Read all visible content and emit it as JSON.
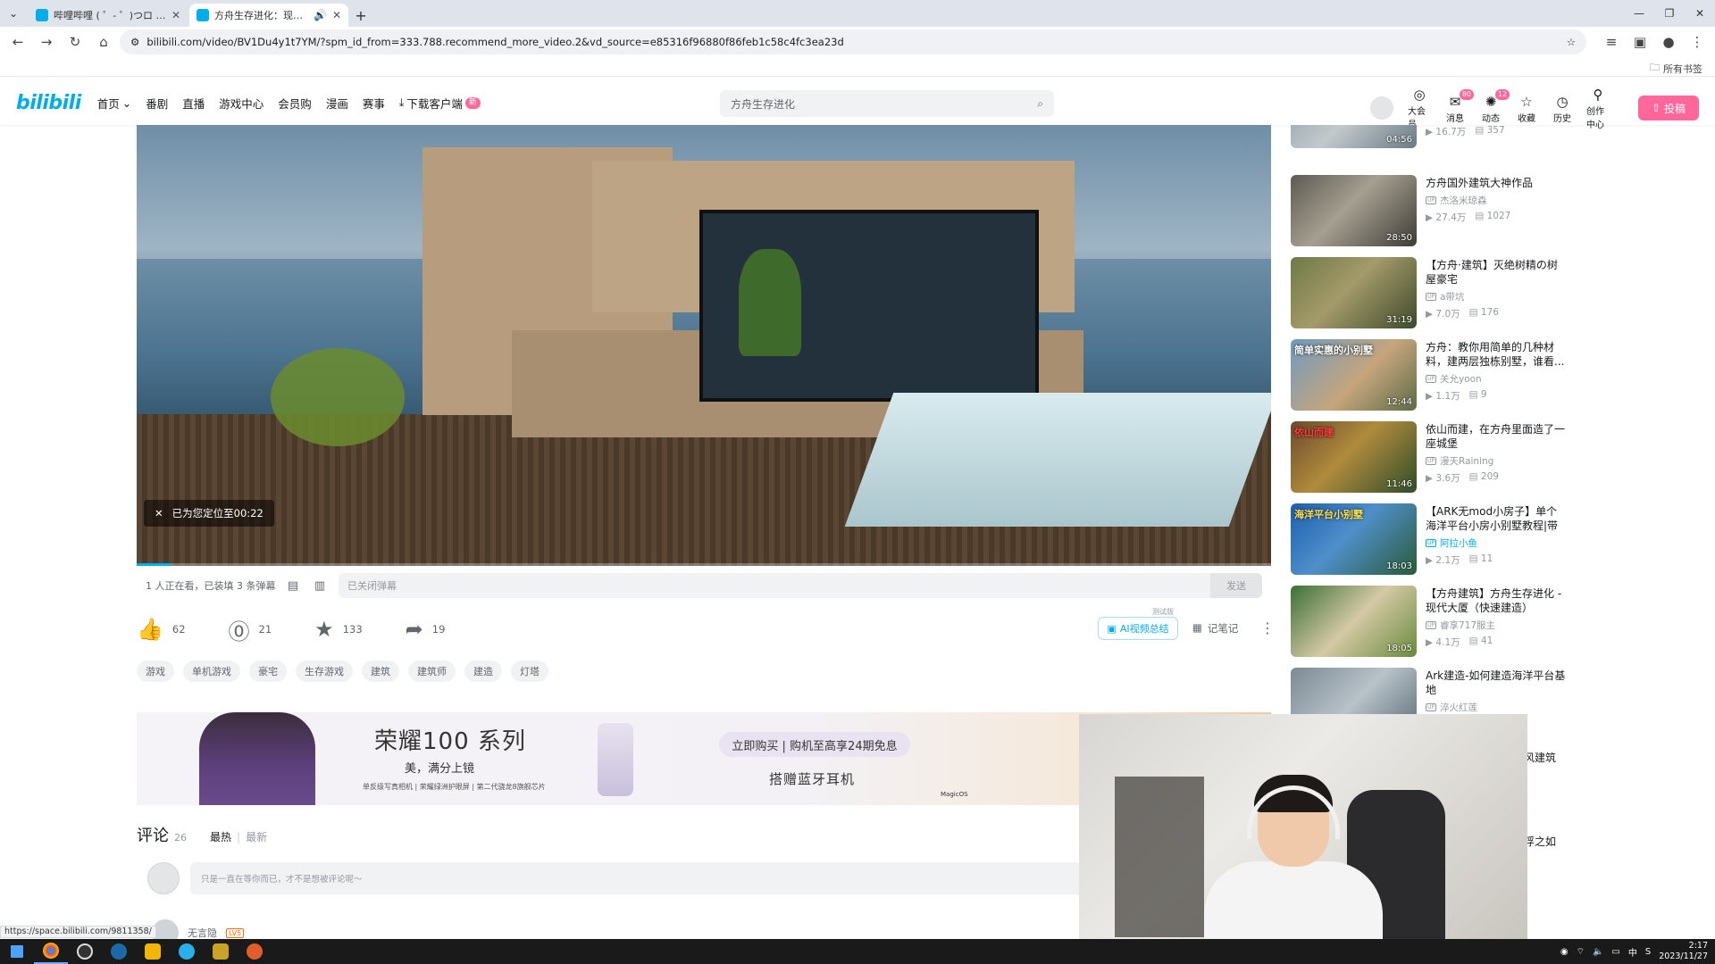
{
  "browser": {
    "tabs": [
      {
        "title": "哔哩哔哩 ( ゜- ゜)つロ 干杯~-bilibili",
        "active": false
      },
      {
        "title": "方舟生存进化：现代豪宅建造",
        "active": true
      }
    ],
    "new_tab": "+",
    "url": "bilibili.com/video/BV1Du4y1t7YM/?spm_id_from=333.788.recommend_more_video.2&vd_source=e85316f96880f86feb1c58c4fc3ea23d",
    "all_bookmarks": "所有书签"
  },
  "header": {
    "logo": "bilibili",
    "nav": [
      {
        "label": "首页"
      },
      {
        "label": "番剧"
      },
      {
        "label": "直播"
      },
      {
        "label": "游戏中心"
      },
      {
        "label": "会员购"
      },
      {
        "label": "漫画"
      },
      {
        "label": "赛事"
      },
      {
        "label": "下载客户端"
      }
    ],
    "download_badge": "新",
    "search_placeholder": "方舟生存进化",
    "right_nav": [
      {
        "label": "大会员",
        "icon": "vip-icon",
        "count": ""
      },
      {
        "label": "消息",
        "icon": "message-icon",
        "count": "80"
      },
      {
        "label": "动态",
        "icon": "dynamic-icon",
        "count": "12"
      },
      {
        "label": "收藏",
        "icon": "favorite-icon",
        "count": ""
      },
      {
        "label": "历史",
        "icon": "history-icon",
        "count": ""
      },
      {
        "label": "创作中心",
        "icon": "creator-icon",
        "count": ""
      }
    ],
    "upload_label": "投稿",
    "accent": "#00aeec",
    "pink": "#ff6699"
  },
  "player": {
    "toast": "已为您定位至00:22",
    "progress": 0.03
  },
  "danmaku": {
    "watching": "1 人正在看，已装填 3 条弹幕",
    "input_placeholder": "已关闭弹幕",
    "send": "发送"
  },
  "actions": {
    "like": "62",
    "coin": "21",
    "favorite": "133",
    "share": "19",
    "ai_summary": "AI视频总结",
    "ai_test": "测试版",
    "notes": "记笔记"
  },
  "tags": [
    "游戏",
    "单机游戏",
    "豪宅",
    "生存游戏",
    "建筑",
    "建筑师",
    "建造",
    "灯塔"
  ],
  "ad": {
    "headline": "荣耀100 系列",
    "sub": "美，满分上镜",
    "fine": "单反级写真相机 | 荣耀绿洲护眼屏 | 第二代骁龙8旗舰芯片",
    "pill": "立即购买 | 购机至高享24期免息",
    "gift": "搭赠蓝牙耳机",
    "brand": "MagicOS"
  },
  "comments": {
    "title": "评论",
    "count": "26",
    "sort_hot": "最热",
    "sort_sep": "|",
    "sort_new": "最新",
    "input_placeholder": "只是一直在等你而已，才不是想被评论呢～",
    "first_user": "无言隐",
    "first_user_level": "LV5"
  },
  "recommendations": [
    {
      "title": "",
      "up": "",
      "views": "16.7万",
      "danmaku": "357",
      "duration": "04:56",
      "overlay": "",
      "charged": false
    },
    {
      "title": "方舟国外建筑大神作品",
      "up": "杰洛米琼森",
      "views": "27.4万",
      "danmaku": "1027",
      "duration": "28:50",
      "overlay": "",
      "charged": false
    },
    {
      "title": "【方舟·建筑】灭绝树精の树屋豪宅",
      "up": "a带坑",
      "views": "7.0万",
      "danmaku": "176",
      "duration": "31:19",
      "overlay": "",
      "charged": false
    },
    {
      "title": "方舟：教你用简单的几种材料，建两层独栋别墅，谁看...",
      "up": "关允yoon",
      "views": "1.1万",
      "danmaku": "9",
      "duration": "12:44",
      "overlay": "简单实惠的小别墅",
      "charged": false
    },
    {
      "title": "依山而建，在方舟里面造了一座城堡",
      "up": "漫天Raining",
      "views": "3.6万",
      "danmaku": "209",
      "duration": "11:46",
      "overlay": "依山而建",
      "charged": false
    },
    {
      "title": "【ARK无mod小房子】单个海洋平台小房小别墅教程|带水...",
      "up": "阿拉小鱼",
      "views": "2.1万",
      "danmaku": "11",
      "duration": "18:03",
      "overlay": "海洋平台小别墅",
      "charged": true
    },
    {
      "title": "【方舟建筑】方舟生存进化 - 现代大厦（快速建造）",
      "up": "睿享717服主",
      "views": "4.1万",
      "danmaku": "41",
      "duration": "18:05",
      "overlay": "",
      "charged": false
    },
    {
      "title": "Ark建造-如何建造海洋平台基地",
      "up": "淬火红莲",
      "views": "",
      "danmaku": "",
      "duration": "",
      "overlay": "",
      "charged": false
    }
  ],
  "rec_partial": [
    "风建筑",
    "浮之如"
  ],
  "status_url": "https://space.bilibili.com/9811358/",
  "taskbar": {
    "time": "2:17",
    "date": "2023/11/27",
    "ime": "中"
  }
}
